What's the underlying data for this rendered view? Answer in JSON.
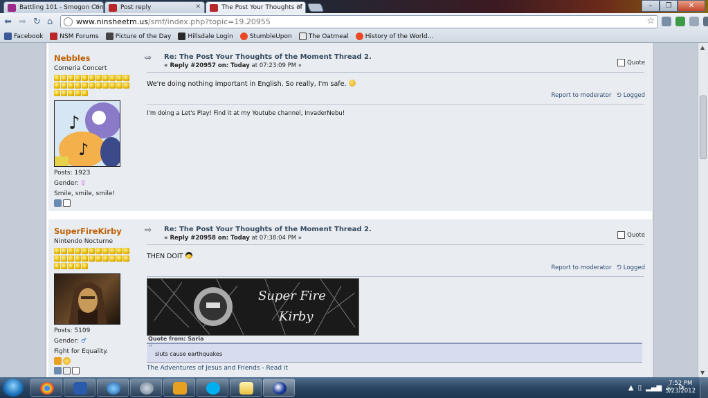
{
  "browser": {
    "tabs": [
      {
        "title": "Battling 101 - Smogon Com",
        "active": false
      },
      {
        "title": "Post reply",
        "active": false
      },
      {
        "title": "The Post Your Thoughts of",
        "active": true
      }
    ],
    "address": {
      "host": "www.ninsheetm.us",
      "path": "/smf/index.php?topic=19.20955"
    },
    "bookmarks": [
      "Facebook",
      "NSM Forums",
      "Picture of the Day",
      "Hillsdale Login",
      "StumbleUpon",
      "The Oatmeal",
      "History of the World..."
    ]
  },
  "posts": [
    {
      "poster": "Nebbles",
      "group": "Corneria Concert",
      "star_count": 27,
      "posts_label": "Posts: 1923",
      "gender_label": "Gender:",
      "personal_text": "Smile, smile, smile!",
      "title": "Re: The Post Your Thoughts of the Moment Thread 2.",
      "reply_prefix": "« Reply #20957 on: ",
      "reply_day": "Today",
      "reply_time": " at 07:23:09 PM »",
      "quote_label": "Quote",
      "body": "We're doing nothing important in English. So really, I'm safe.",
      "report_label": "Report to moderator",
      "logged_label": "Logged",
      "signature": "I'm doing a Let's Play! Find it at my Youtube channel, InvaderNebu!"
    },
    {
      "poster": "SuperFireKirby",
      "group": "Nintendo Nocturne",
      "star_count": 27,
      "posts_label": "Posts: 5109",
      "gender_label": "Gender:",
      "personal_text": "Fight for Equality.",
      "title": "Re: The Post Your Thoughts of the Moment Thread 2.",
      "reply_prefix": "« Reply #20958 on: ",
      "reply_day": "Today",
      "reply_time": " at 07:38:04 PM »",
      "quote_label": "Quote",
      "body": "THEN DOIT",
      "report_label": "Report to moderator",
      "logged_label": "Logged",
      "banner_text_1": "Super Fire",
      "banner_text_2": "Kirby",
      "quote_from": "Quote from: Saria",
      "quote_text": "sluts cause earthquakes",
      "sig_link": "The Adventures of Jesus and Friends - Read it"
    }
  ],
  "taskbar": {
    "time": "7:52 PM",
    "date": "5/23/2012"
  },
  "colors": {
    "poster_name": "#c06002",
    "post_bg": "#e9edf2",
    "link": "#2c4a6e"
  }
}
